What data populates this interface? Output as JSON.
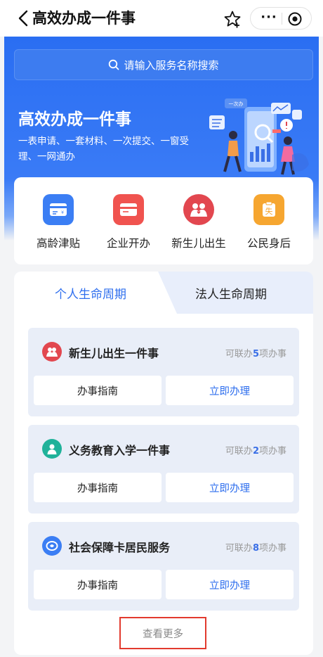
{
  "nav": {
    "title": "高效办成一件事",
    "more": "···"
  },
  "search": {
    "placeholder": "请输入服务名称搜索"
  },
  "hero": {
    "title": "高效办成一件事",
    "subtitle": "一表申请、一套材料、一次提交、一窗受理、一网通办",
    "illustration_badge": "一次办"
  },
  "quick": [
    {
      "label": "高龄津贴",
      "icon": "allowance-card-icon",
      "color": "#3b7ef4"
    },
    {
      "label": "企业开办",
      "icon": "business-card-icon",
      "color": "#f0534f"
    },
    {
      "label": "新生儿出生",
      "icon": "family-icon",
      "color": "#e2474f"
    },
    {
      "label": "公民身后",
      "icon": "document-icon",
      "color": "#f6a630",
      "glyph": "失"
    }
  ],
  "tabs": {
    "personal": "个人生命周期",
    "corporate": "法人生命周期"
  },
  "cards": [
    {
      "title": "新生儿出生一件事",
      "count_prefix": "可联办",
      "count": "5",
      "count_suffix": "项办事",
      "guide": "办事指南",
      "apply": "立即办理",
      "icon": "baby-icon",
      "color": "#e2474f"
    },
    {
      "title": "义务教育入学一件事",
      "count_prefix": "可联办",
      "count": "2",
      "count_suffix": "项办事",
      "guide": "办事指南",
      "apply": "立即办理",
      "icon": "student-icon",
      "color": "#20b29a"
    },
    {
      "title": "社会保障卡居民服务",
      "count_prefix": "可联办",
      "count": "8",
      "count_suffix": "项办事",
      "guide": "办事指南",
      "apply": "立即办理",
      "icon": "social-security-icon",
      "color": "#3b7ef4"
    }
  ],
  "more": "查看更多"
}
